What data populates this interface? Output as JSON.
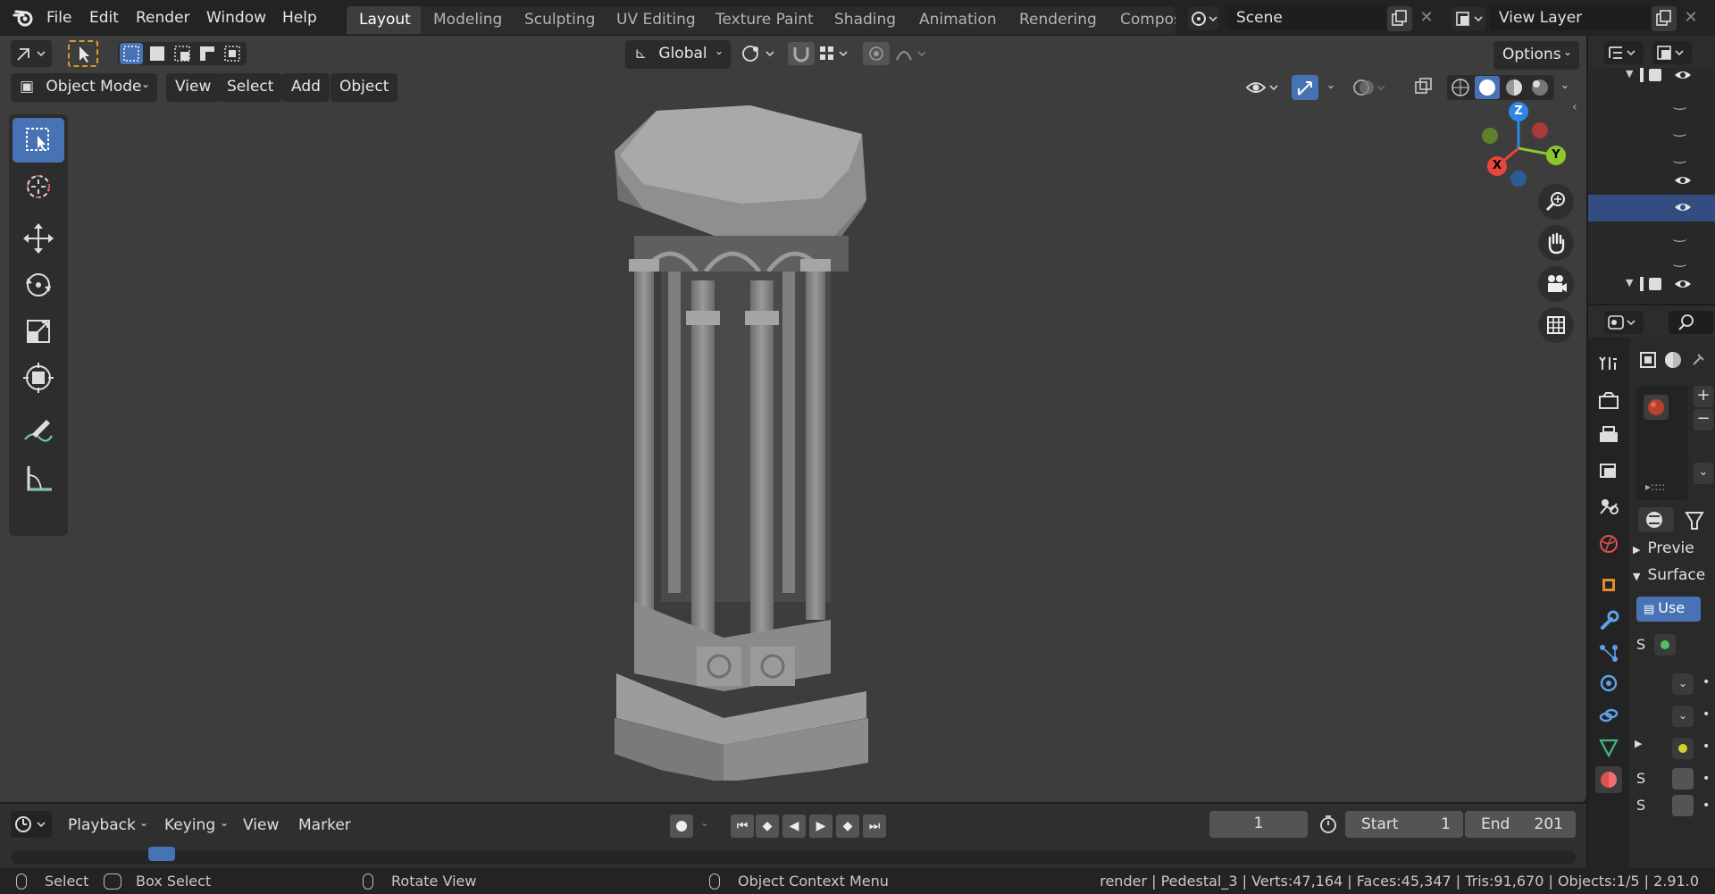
{
  "menus": [
    "File",
    "Edit",
    "Render",
    "Window",
    "Help"
  ],
  "workspace_tabs": [
    {
      "label": "Layout",
      "active": true
    },
    {
      "label": "Modeling"
    },
    {
      "label": "Sculpting"
    },
    {
      "label": "UV Editing"
    },
    {
      "label": "Texture Paint"
    },
    {
      "label": "Shading"
    },
    {
      "label": "Animation"
    },
    {
      "label": "Rendering"
    },
    {
      "label": "Compos"
    }
  ],
  "scene_field": "Scene",
  "view_layer_field": "View Layer",
  "header": {
    "transform_orientation": "Global",
    "options": "Options",
    "mode": "Object Mode",
    "view": "View",
    "select": "Select",
    "add": "Add",
    "object": "Object"
  },
  "gizmo": {
    "x": "X",
    "y": "Y",
    "z": "Z"
  },
  "properties": {
    "preview": "Previe",
    "surface": "Surface",
    "use": "Use",
    "s1": "S",
    "s2": "S",
    "s3": "S"
  },
  "timeline": {
    "playback": "Playback",
    "keying": "Keying",
    "view": "View",
    "marker": "Marker",
    "current_frame": "1",
    "start_label": "Start",
    "start_value": "1",
    "end_label": "End",
    "end_value": "201"
  },
  "statusbar": {
    "select": "Select",
    "box_select": "Box Select",
    "rotate_view": "Rotate View",
    "context_menu": "Object Context Menu",
    "stats": "render | Pedestal_3 | Verts:47,164 | Faces:45,347 | Tris:91,670 | Objects:1/5 | 2.91.0"
  },
  "colors": {
    "accent": "#4772b3",
    "axis_x": "#e8453c",
    "axis_y": "#8bc72c",
    "axis_z": "#2f86e5"
  },
  "icons": [
    "blender-logo-icon",
    "select-box-icon",
    "cursor-icon",
    "move-icon",
    "rotate-icon",
    "scale-icon",
    "transform-icon",
    "annotate-icon",
    "measure-icon",
    "zoom-icon",
    "hand-icon",
    "camera-icon",
    "grid-icon",
    "eye-icon",
    "wrench-icon",
    "material-icon"
  ]
}
